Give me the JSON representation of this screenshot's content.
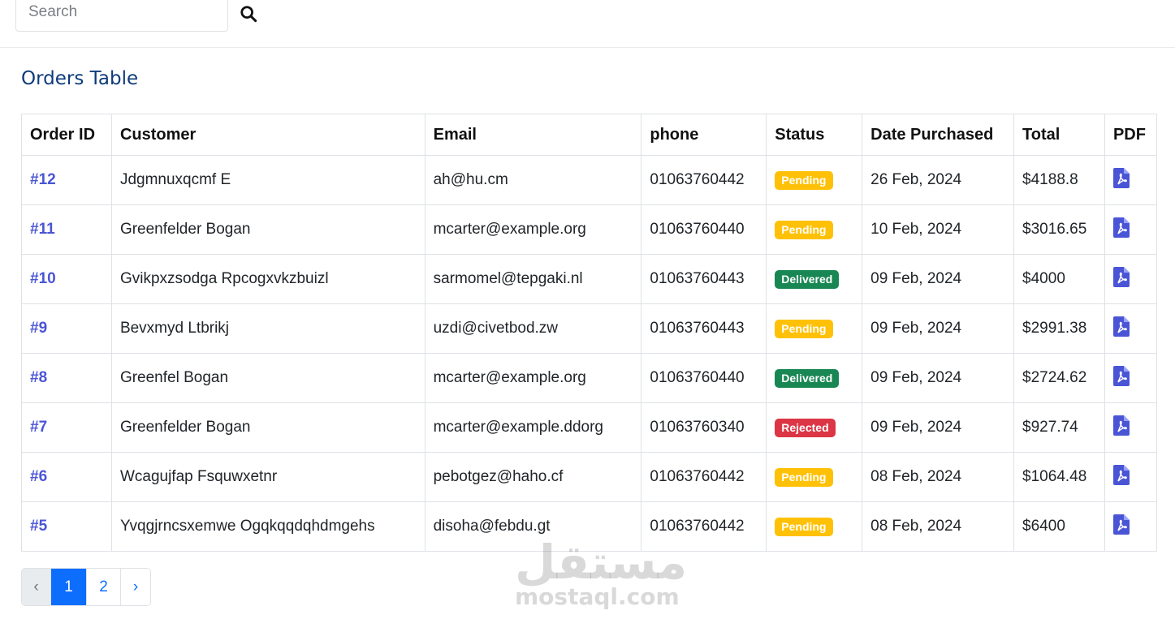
{
  "search": {
    "placeholder": "Search"
  },
  "title": "Orders Table",
  "table": {
    "headers": [
      "Order ID",
      "Customer",
      "Email",
      "phone",
      "Status",
      "Date Purchased",
      "Total",
      "PDF"
    ],
    "rows": [
      {
        "id": "#12",
        "customer": "Jdgmnuxqcmf E",
        "email": "ah@hu.cm",
        "phone": "01063760442",
        "status": "Pending",
        "date": "26 Feb, 2024",
        "total": "$4188.8"
      },
      {
        "id": "#11",
        "customer": "Greenfelder Bogan",
        "email": "mcarter@example.org",
        "phone": "01063760440",
        "status": "Pending",
        "date": "10 Feb, 2024",
        "total": "$3016.65"
      },
      {
        "id": "#10",
        "customer": "Gvikpxzsodga Rpcogxvkzbuizl",
        "email": "sarmomel@tepgaki.nl",
        "phone": "01063760443",
        "status": "Delivered",
        "date": "09 Feb, 2024",
        "total": "$4000"
      },
      {
        "id": "#9",
        "customer": "Bevxmyd Ltbrikj",
        "email": "uzdi@civetbod.zw",
        "phone": "01063760443",
        "status": "Pending",
        "date": "09 Feb, 2024",
        "total": "$2991.38"
      },
      {
        "id": "#8",
        "customer": "Greenfel Bogan",
        "email": "mcarter@example.org",
        "phone": "01063760440",
        "status": "Delivered",
        "date": "09 Feb, 2024",
        "total": "$2724.62"
      },
      {
        "id": "#7",
        "customer": "Greenfelder Bogan",
        "email": "mcarter@example.ddorg",
        "phone": "01063760340",
        "status": "Rejected",
        "date": "09 Feb, 2024",
        "total": "$927.74"
      },
      {
        "id": "#6",
        "customer": "Wcagujfap Fsquwxetnr",
        "email": "pebotgez@haho.cf",
        "phone": "01063760442",
        "status": "Pending",
        "date": "08 Feb, 2024",
        "total": "$1064.48"
      },
      {
        "id": "#5",
        "customer": "Yvqgjrncsxemwe Ogqkqqdqhdmgehs",
        "email": "disoha@febdu.gt",
        "phone": "01063760442",
        "status": "Pending",
        "date": "08 Feb, 2024",
        "total": "$6400"
      }
    ]
  },
  "pagination": {
    "prev": "‹",
    "pages": [
      "1",
      "2"
    ],
    "active": "1",
    "next": "›"
  },
  "watermark": {
    "logo": "مستقل",
    "text": "mostaql.com"
  },
  "colors": {
    "title": "#0f3b7a",
    "order_id": "#4a55d6",
    "pending": "#ffc107",
    "delivered": "#198754",
    "rejected": "#dc3545",
    "pdf_icon": "#4a55d6",
    "active_page": "#0d6efd"
  },
  "icons": {
    "search": "search-icon",
    "pdf": "pdf-file-icon"
  }
}
